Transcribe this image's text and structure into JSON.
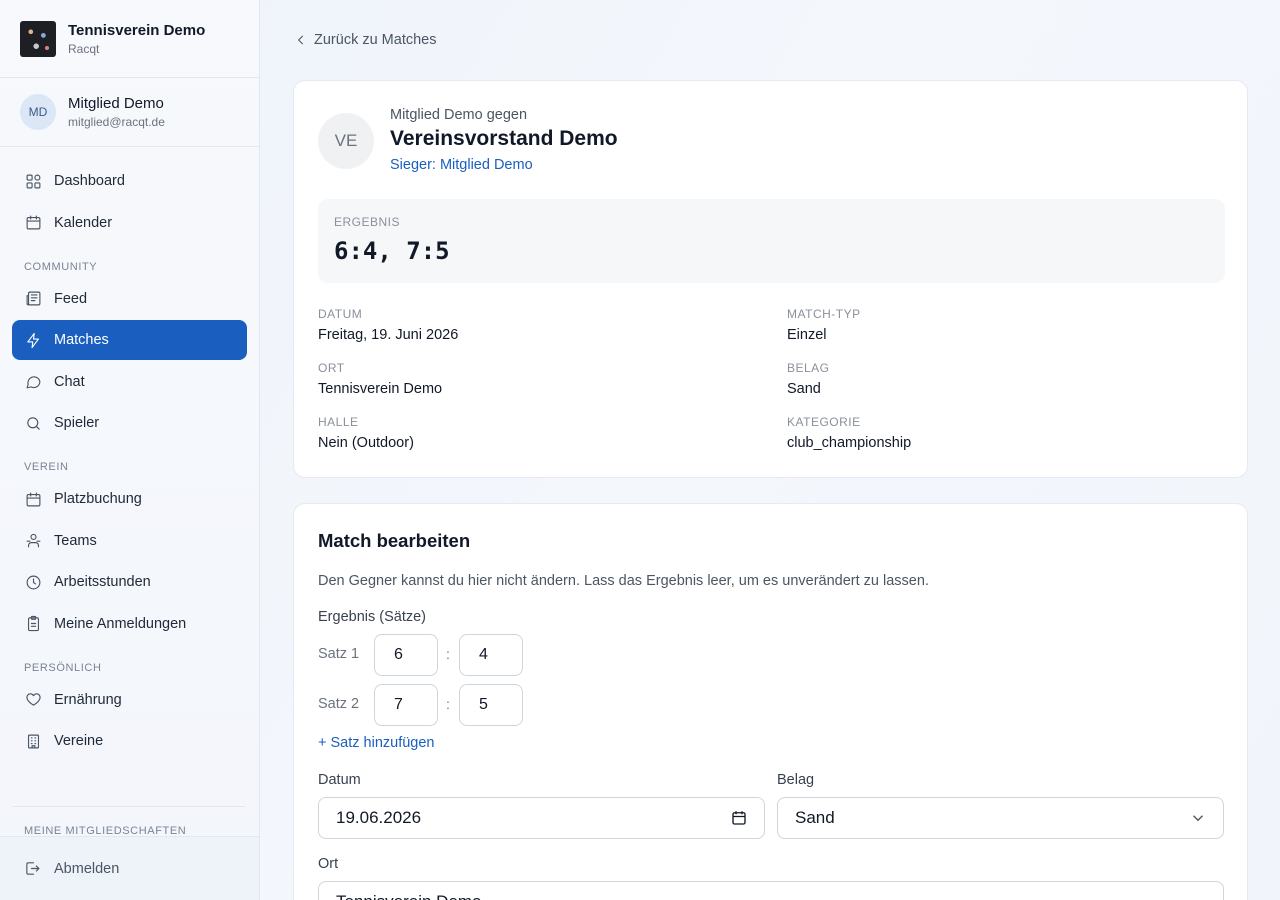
{
  "club": {
    "name": "Tennisverein Demo",
    "subtitle": "Racqt"
  },
  "user": {
    "initials": "MD",
    "name": "Mitglied Demo",
    "email": "mitglied@racqt.de"
  },
  "nav": {
    "dashboard": "Dashboard",
    "kalender": "Kalender",
    "section_community": "COMMUNITY",
    "feed": "Feed",
    "matches": "Matches",
    "chat": "Chat",
    "spieler": "Spieler",
    "section_verein": "VEREIN",
    "platzbuchung": "Platzbuchung",
    "teams": "Teams",
    "arbeitsstunden": "Arbeitsstunden",
    "anmeldungen": "Meine Anmeldungen",
    "section_persoenlich": "PERSÖNLICH",
    "ernaehrung": "Ernährung",
    "vereine": "Vereine",
    "section_mitgliedschaften": "MEINE MITGLIEDSCHAFTEN",
    "logout": "Abmelden"
  },
  "back_link": "Zurück zu Matches",
  "match": {
    "opponent_initials": "VE",
    "vs_line": "Mitglied Demo gegen",
    "opponent_name": "Vereinsvorstand Demo",
    "winner": "Sieger: Mitglied Demo",
    "result_label": "ERGEBNIS",
    "result_value": "6:4, 7:5",
    "details": {
      "datum_label": "DATUM",
      "datum_value": "Freitag, 19. Juni 2026",
      "typ_label": "MATCH-TYP",
      "typ_value": "Einzel",
      "ort_label": "ORT",
      "ort_value": "Tennisverein Demo",
      "belag_label": "BELAG",
      "belag_value": "Sand",
      "halle_label": "HALLE",
      "halle_value": "Nein (Outdoor)",
      "kategorie_label": "KATEGORIE",
      "kategorie_value": "club_championship"
    }
  },
  "edit": {
    "title": "Match bearbeiten",
    "hint": "Den Gegner kannst du hier nicht ändern. Lass das Ergebnis leer, um es unverändert zu lassen.",
    "result_label": "Ergebnis (Sätze)",
    "sets": [
      {
        "label": "Satz 1",
        "a": "6",
        "b": "4"
      },
      {
        "label": "Satz 2",
        "a": "7",
        "b": "5"
      }
    ],
    "separator": ":",
    "add_set": "+ Satz hinzufügen",
    "datum_label": "Datum",
    "datum_value": "19.06.2026",
    "belag_label": "Belag",
    "belag_value": "Sand",
    "ort_label": "Ort",
    "ort_value": "Tennisverein Demo"
  },
  "icons": {
    "dashboard": "grid-icon",
    "kalender": "calendar-icon",
    "feed": "newspaper-icon",
    "matches": "lightning-icon",
    "chat": "speech-bubble-icon",
    "spieler": "search-icon",
    "platzbuchung": "calendar-icon",
    "teams": "people-icon",
    "arbeitsstunden": "clock-icon",
    "anmeldungen": "clipboard-icon",
    "ernaehrung": "heart-icon",
    "vereine": "building-icon",
    "logout": "logout-icon"
  },
  "colors": {
    "accent": "#1a5fbf",
    "active_nav_bg": "#1a5fbf"
  }
}
